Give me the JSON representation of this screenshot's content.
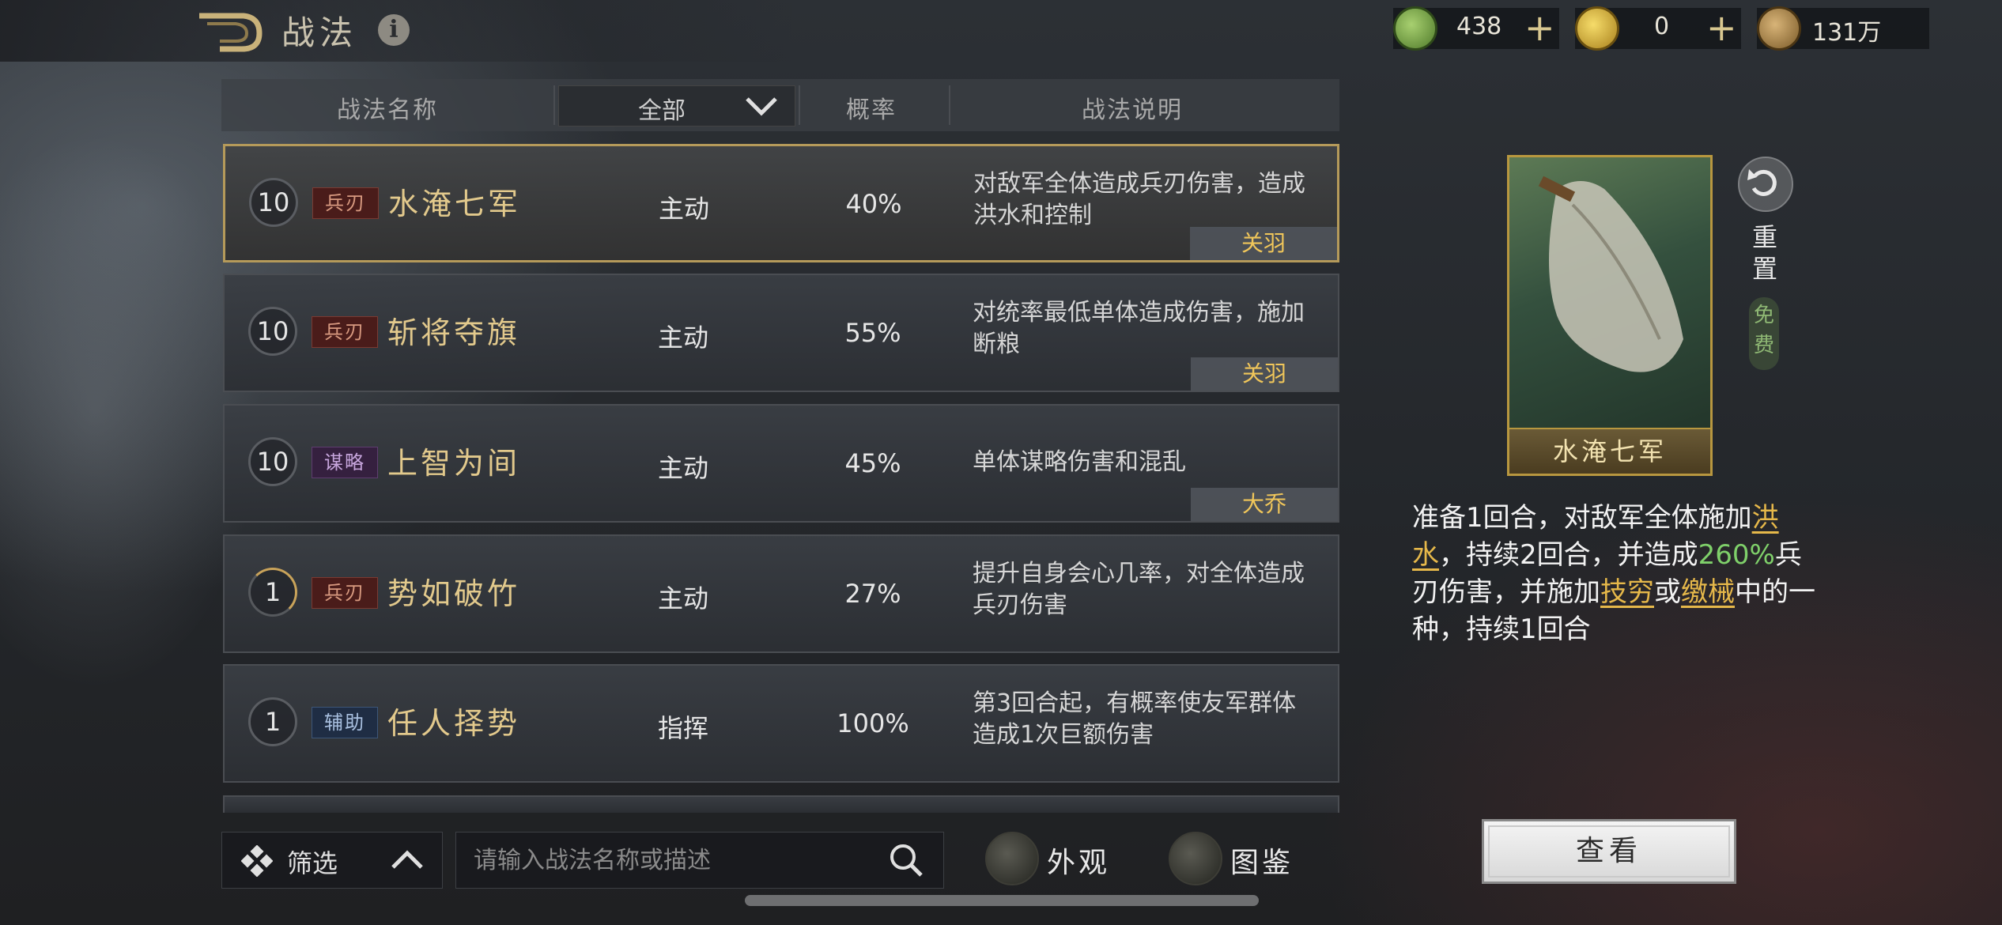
{
  "header": {
    "title": "战法",
    "currencies": [
      {
        "name": "jade-icon",
        "value": "438",
        "color": "#7aa84a"
      },
      {
        "name": "gold-coin-icon",
        "value": "0",
        "color": "#d9b238"
      },
      {
        "name": "copper-coin-icon",
        "value": "131万",
        "color": "#a8884a"
      }
    ],
    "plus": "+"
  },
  "list_header": {
    "name_col": "战法名称",
    "filter_value": "全部",
    "rate_col": "概率",
    "desc_col": "战法说明"
  },
  "skills": [
    {
      "level": "10",
      "type": "兵刃",
      "name": "水淹七军",
      "kind": "主动",
      "rate": "40%",
      "desc": "对敌军全体造成兵刃伤害，造成洪水和控制",
      "owner": "关羽"
    },
    {
      "level": "10",
      "type": "兵刃",
      "name": "斩将夺旗",
      "kind": "主动",
      "rate": "55%",
      "desc": "对统率最低单体造成伤害，施加断粮",
      "owner": "关羽"
    },
    {
      "level": "10",
      "type": "谋略",
      "name": "上智为间",
      "kind": "主动",
      "rate": "45%",
      "desc": "单体谋略伤害和混乱",
      "owner": "大乔"
    },
    {
      "level": "1",
      "type": "兵刃",
      "name": "势如破竹",
      "kind": "主动",
      "rate": "27%",
      "desc": "提升自身会心几率，对全体造成兵刃伤害",
      "owner": ""
    },
    {
      "level": "1",
      "type": "辅助",
      "name": "任人择势",
      "kind": "指挥",
      "rate": "100%",
      "desc": "第3回合起，有概率使友军群体造成1次巨额伤害",
      "owner": ""
    }
  ],
  "bottom": {
    "filter_label": "筛选",
    "search_placeholder": "请输入战法名称或描述",
    "appearance_label": "外观",
    "codex_label": "图鉴"
  },
  "detail": {
    "card_name": "水淹七军",
    "reset_label": "重置",
    "free_label": "免费",
    "desc_parts": [
      "准备1回合，对敌军全体施加",
      "洪水",
      "，持续2回合，并造成",
      "260%",
      "兵刃伤害，并施加",
      "技穷",
      "或",
      "缴械",
      "中的一种，持续1回合"
    ],
    "view_button": "查看"
  }
}
